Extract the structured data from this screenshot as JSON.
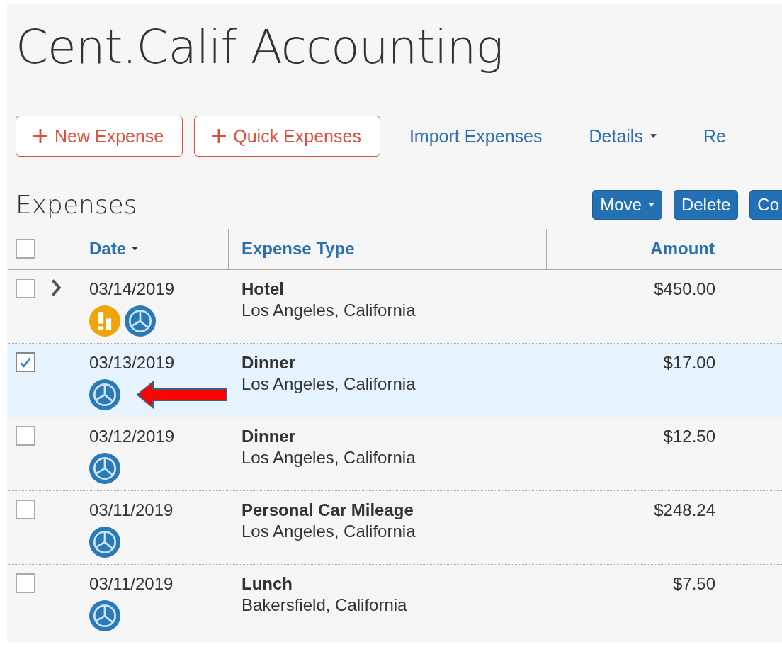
{
  "title": "Cent.Calif Accounting",
  "toolbar": [
    {
      "kind": "outline",
      "label": "New Expense"
    },
    {
      "kind": "outline",
      "label": "Quick Expenses"
    },
    {
      "kind": "link",
      "label": "Import Expenses"
    },
    {
      "kind": "dropdown",
      "label": "Details"
    },
    {
      "kind": "link",
      "label": "Re"
    }
  ],
  "section_title": "Expenses",
  "actions": [
    {
      "label": "Move",
      "dropdown": true
    },
    {
      "label": "Delete",
      "dropdown": false
    },
    {
      "label": "Co",
      "dropdown": false
    }
  ],
  "table": {
    "select_all": {
      "checked": false
    },
    "columns": [
      {
        "label": "Date",
        "sorted": true
      },
      {
        "label": "Expense Type",
        "sorted": false
      },
      {
        "label": "Amount",
        "sorted": false
      }
    ],
    "rows": [
      {
        "checked": false,
        "selected": false,
        "expandable": true,
        "date": "03/14/2019",
        "type": "Hotel",
        "location": "Los Angeles, California",
        "amount": "$450.00",
        "icons": [
          {
            "kind": "alert"
          },
          {
            "kind": "ereceipt"
          }
        ],
        "pointer": false
      },
      {
        "checked": true,
        "selected": true,
        "expandable": false,
        "date": "03/13/2019",
        "type": "Dinner",
        "location": "Los Angeles, California",
        "amount": "$17.00",
        "icons": [
          {
            "kind": "ereceipt"
          }
        ],
        "pointer": true
      },
      {
        "checked": false,
        "selected": false,
        "expandable": false,
        "date": "03/12/2019",
        "type": "Dinner",
        "location": "Los Angeles, California",
        "amount": "$12.50",
        "icons": [
          {
            "kind": "ereceipt"
          }
        ],
        "pointer": false
      },
      {
        "checked": false,
        "selected": false,
        "expandable": false,
        "date": "03/11/2019",
        "type": "Personal Car Mileage",
        "location": "Los Angeles, California",
        "amount": "$248.24",
        "icons": [
          {
            "kind": "ereceipt"
          }
        ],
        "pointer": false
      },
      {
        "checked": false,
        "selected": false,
        "expandable": false,
        "date": "03/11/2019",
        "type": "Lunch",
        "location": "Bakersfield, California",
        "amount": "$7.50",
        "icons": [
          {
            "kind": "ereceipt"
          }
        ],
        "pointer": false
      }
    ]
  }
}
